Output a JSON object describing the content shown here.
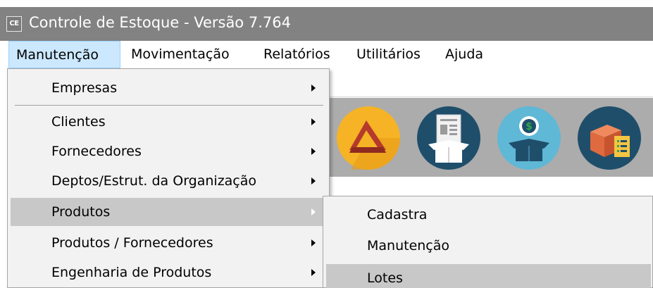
{
  "window": {
    "title": "Controle de Estoque - Versão 7.764",
    "app_icon_text": "CE"
  },
  "menubar": {
    "items": [
      {
        "label": "Manutenção"
      },
      {
        "label": "Movimentação"
      },
      {
        "label": "Relatórios"
      },
      {
        "label": "Utilitários"
      },
      {
        "label": "Ajuda"
      }
    ],
    "active": "Manutenção"
  },
  "manutencao_menu": {
    "items": [
      {
        "label": "Empresas",
        "submenu": true
      },
      {
        "label": "Clientes",
        "submenu": true
      },
      {
        "label": "Fornecedores",
        "submenu": true
      },
      {
        "label": "Deptos/Estrut. da Organização",
        "submenu": true
      },
      {
        "label": "Produtos",
        "submenu": true,
        "highlighted": true
      },
      {
        "label": "Produtos / Fornecedores",
        "submenu": true
      },
      {
        "label": "Engenharia de Produtos",
        "submenu": true
      }
    ]
  },
  "produtos_submenu": {
    "items": [
      {
        "label": "Cadastra"
      },
      {
        "label": "Manutenção"
      },
      {
        "label": "Lotes"
      }
    ]
  },
  "toolbar": {
    "icons": [
      "shapes-icon",
      "invoice-box-icon",
      "money-box-icon",
      "box-checklist-icon"
    ]
  },
  "colors": {
    "titlebar": "#828282",
    "menu_background": "#f2f2f2",
    "menu_highlight": "#c8c8c8",
    "menubar_active": "#cce8ff",
    "toolbar_background": "#acacac"
  }
}
